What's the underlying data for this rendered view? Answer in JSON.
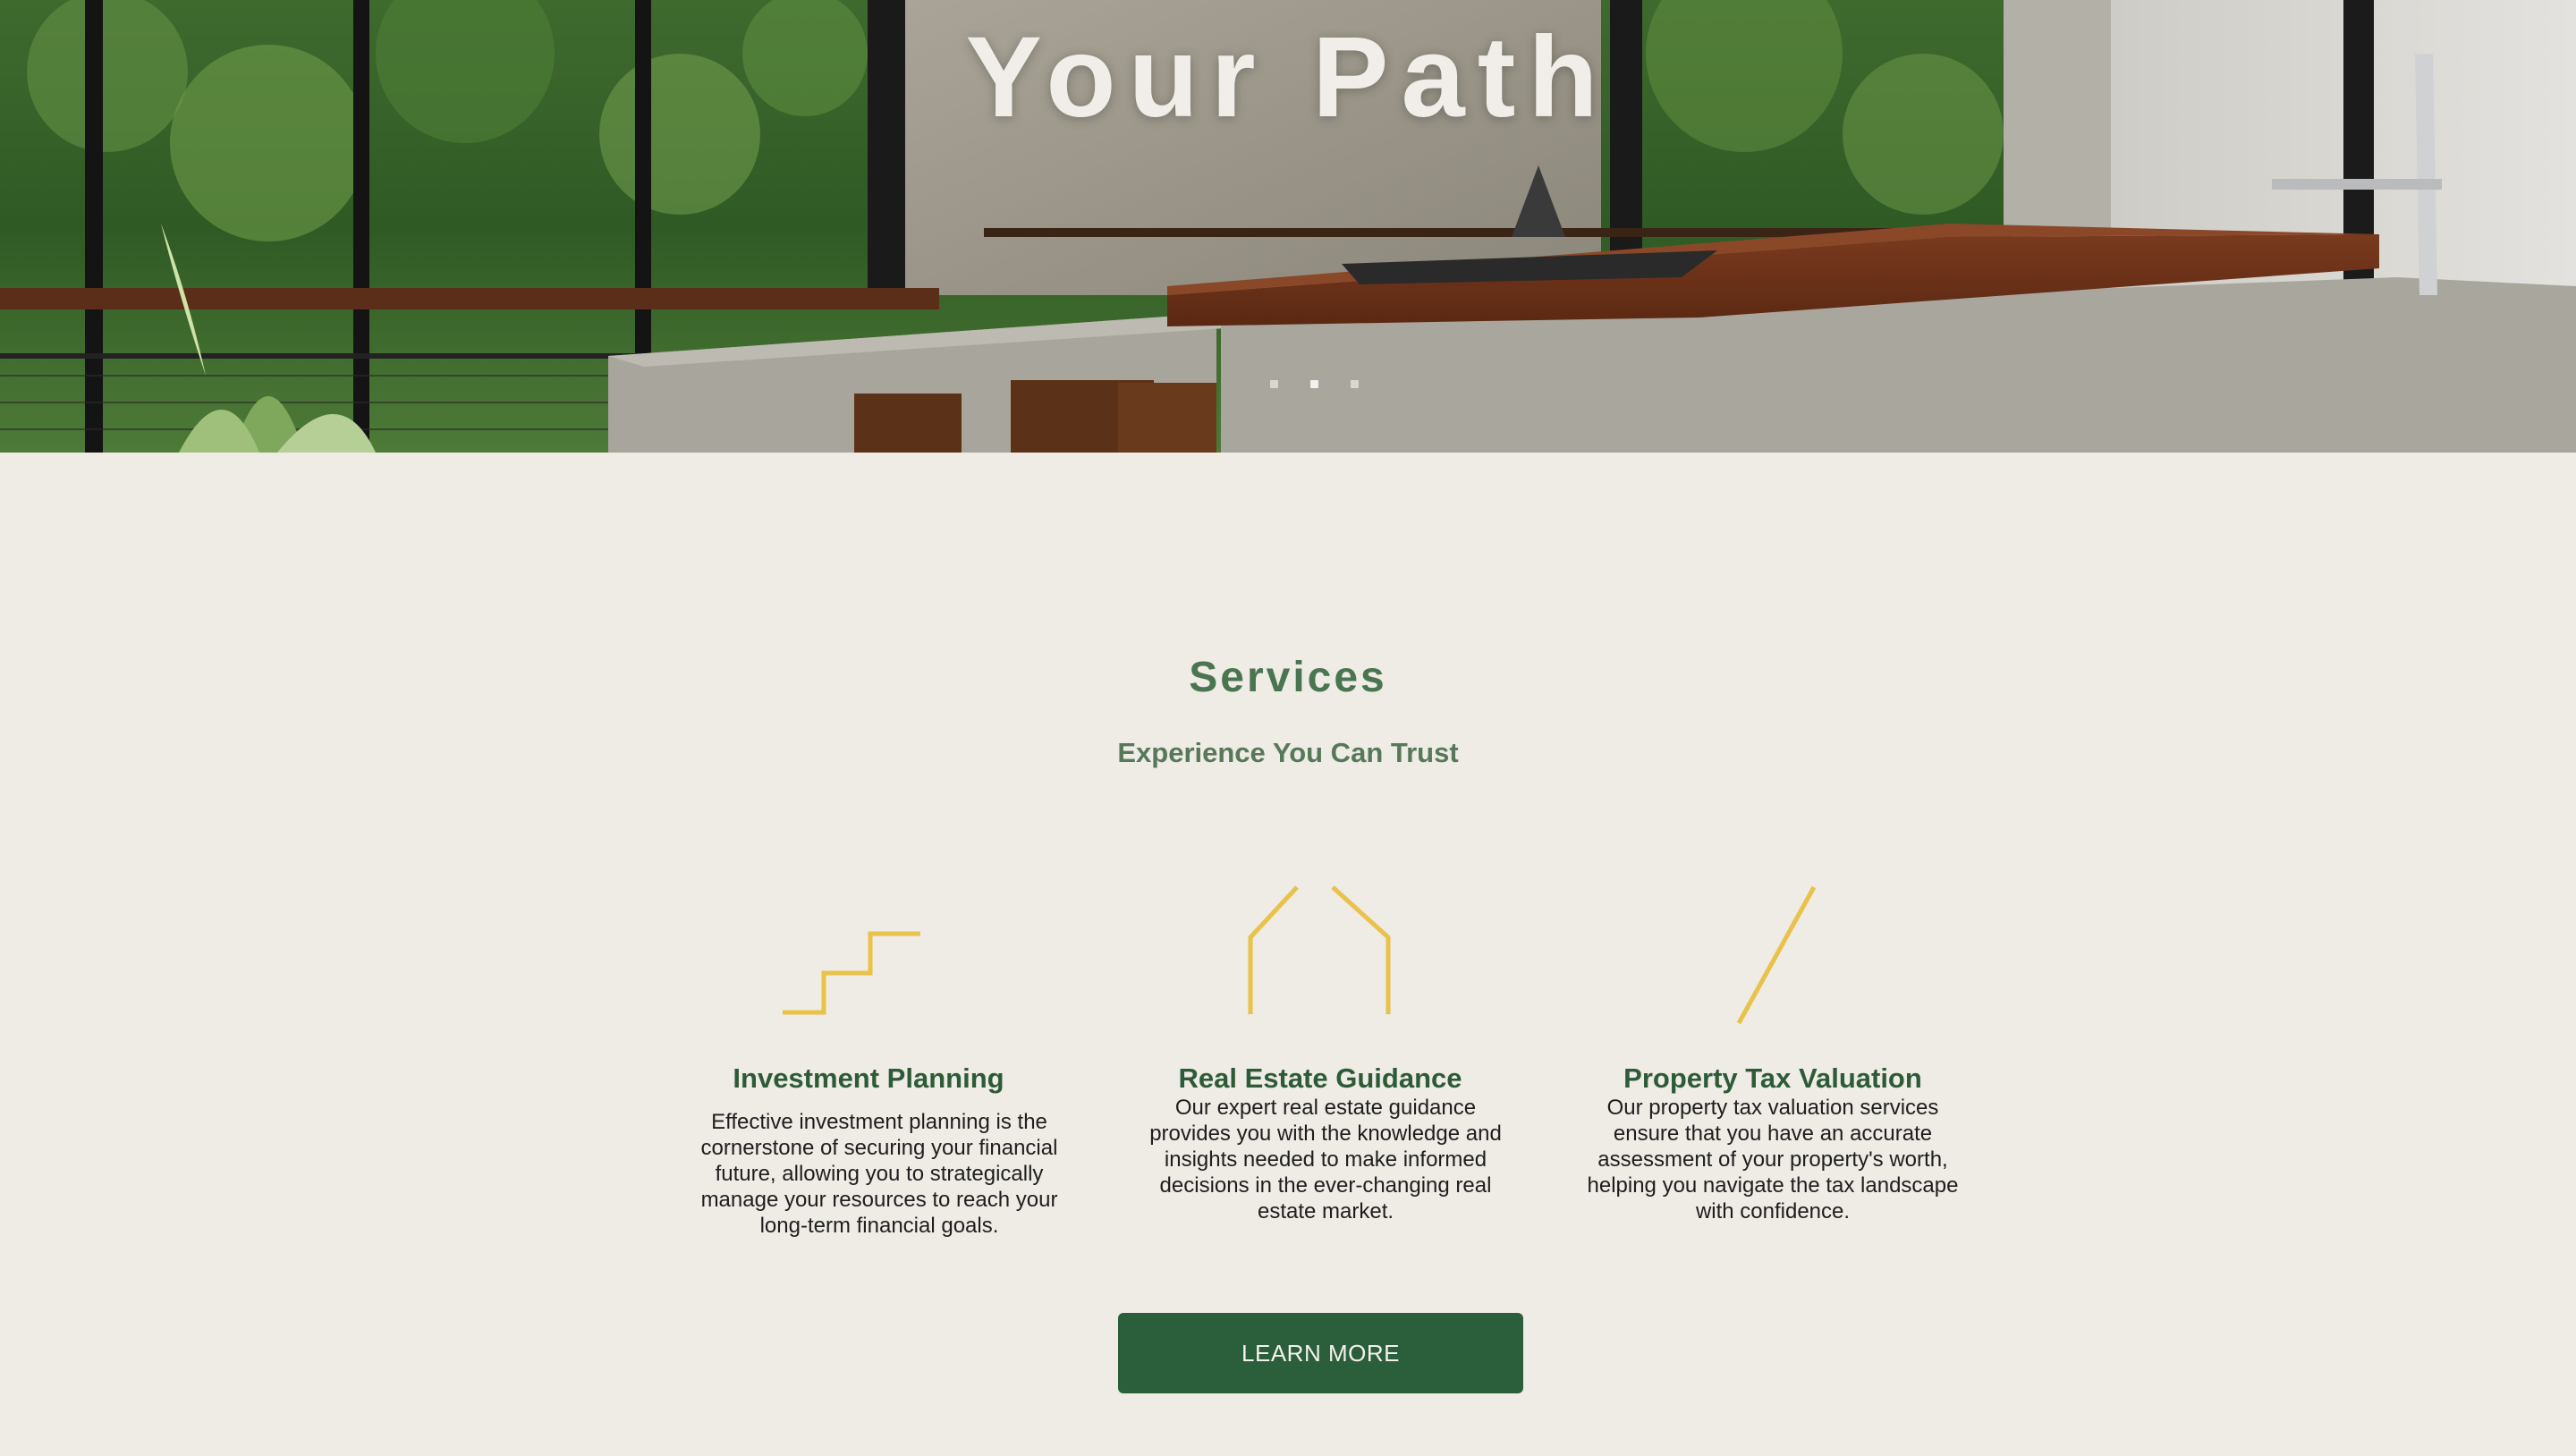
{
  "hero": {
    "title": "Your Path",
    "slides": [
      "slide-1",
      "slide-2",
      "slide-3"
    ],
    "active_slide": 2
  },
  "services": {
    "title": "Services",
    "subtitle": "Experience You Can Trust",
    "items": [
      {
        "icon": "stairs-icon",
        "title": "Investment Planning",
        "description": "Effective investment planning is the cornerstone of securing your financial future, allowing you to strategically manage your resources to reach your long-term financial goals."
      },
      {
        "icon": "house-outline-icon",
        "title": "Real Estate Guidance",
        "description": "Our expert real estate guidance provides you with the knowledge and insights needed to make informed decisions in the ever-changing real estate market."
      },
      {
        "icon": "slash-icon",
        "title": "Property Tax Valuation",
        "description": "Our property tax valuation services ensure that you have an accurate assessment of your property's worth, helping you navigate the tax landscape with confidence."
      }
    ]
  },
  "cta": {
    "label": "LEARN MORE"
  },
  "colors": {
    "background": "#efebe5",
    "accent_green": "#2b5e3b",
    "heading_green": "#4a7551",
    "icon_gold": "#e9c24a",
    "hero_text": "#f1ede8"
  }
}
